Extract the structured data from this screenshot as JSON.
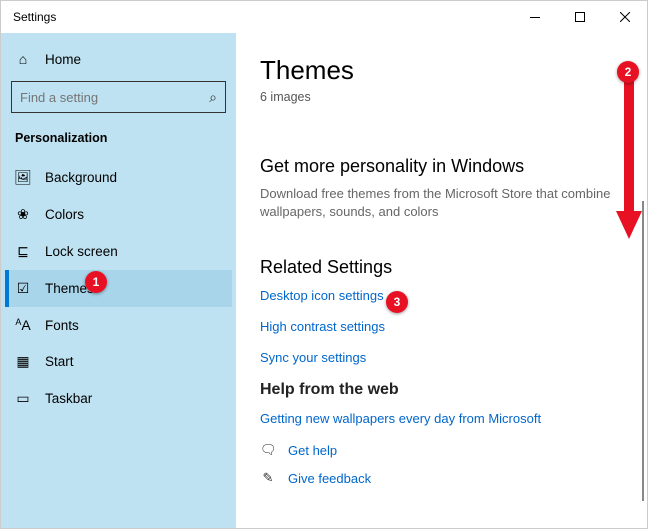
{
  "window": {
    "title": "Settings"
  },
  "sidebar": {
    "home": "Home",
    "search_placeholder": "Find a setting",
    "section": "Personalization",
    "items": [
      {
        "label": "Background"
      },
      {
        "label": "Colors"
      },
      {
        "label": "Lock screen"
      },
      {
        "label": "Themes"
      },
      {
        "label": "Fonts"
      },
      {
        "label": "Start"
      },
      {
        "label": "Taskbar"
      }
    ]
  },
  "main": {
    "title": "Themes",
    "subtitle": "6 images",
    "more_head": "Get more personality in Windows",
    "more_desc": "Download free themes from the Microsoft Store that combine wallpapers, sounds, and colors",
    "related_head": "Related Settings",
    "related_links": {
      "desktop_icon": "Desktop icon settings",
      "high_contrast": "High contrast settings",
      "sync": "Sync your settings"
    },
    "help_head": "Help from the web",
    "help_link": "Getting new wallpapers every day from Microsoft",
    "get_help": "Get help",
    "feedback": "Give feedback"
  },
  "annotations": {
    "b1": "1",
    "b2": "2",
    "b3": "3"
  }
}
